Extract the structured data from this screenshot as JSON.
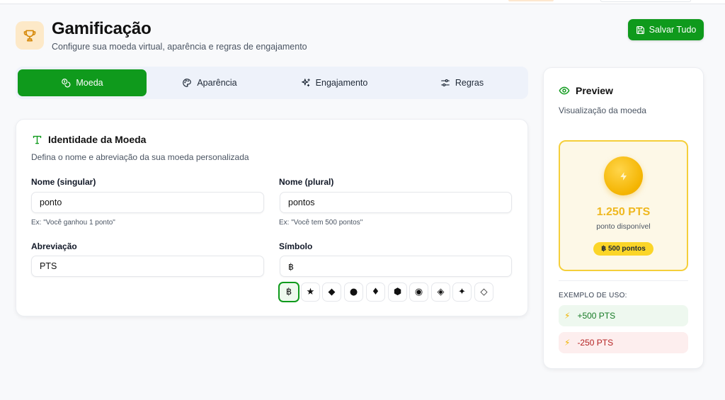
{
  "header": {
    "icon": "trophy-icon",
    "title": "Gamificação",
    "subtitle": "Configure sua moeda virtual, aparência e regras de engajamento",
    "save_label": "Salvar Tudo"
  },
  "tabs": [
    {
      "label": "Moeda",
      "icon": "coins-icon",
      "active": true
    },
    {
      "label": "Aparência",
      "icon": "palette-icon",
      "active": false
    },
    {
      "label": "Engajamento",
      "icon": "sparkles-icon",
      "active": false
    },
    {
      "label": "Regras",
      "icon": "sliders-icon",
      "active": false
    }
  ],
  "identity": {
    "title": "Identidade da Moeda",
    "subtitle": "Defina o nome e abreviação da sua moeda personalizada",
    "singular": {
      "label": "Nome (singular)",
      "value": "ponto",
      "hint": "Ex: \"Você ganhou 1 ponto\""
    },
    "plural": {
      "label": "Nome (plural)",
      "value": "pontos",
      "hint": "Ex: \"Você tem 500 pontos\""
    },
    "abbr": {
      "label": "Abreviação",
      "value": "PTS"
    },
    "symbol": {
      "label": "Símbolo",
      "value": "฿"
    },
    "symbols": [
      "฿",
      "★",
      "◆",
      "●",
      "♦",
      "⬢",
      "◉",
      "◈",
      "✦",
      "◇"
    ],
    "selected_symbol_index": 0
  },
  "preview": {
    "title": "Preview",
    "subtitle": "Visualização da moeda",
    "amount": "1.250 PTS",
    "available": "ponto disponível",
    "pill": "฿ 500 pontos",
    "examples_label": "EXEMPLO DE USO:",
    "example_positive": "+500 PTS",
    "example_negative": "-250 PTS"
  },
  "colors": {
    "accent": "#0f9a1c",
    "coin": "#f4b400",
    "positive": "#167a25",
    "negative": "#b42323"
  }
}
